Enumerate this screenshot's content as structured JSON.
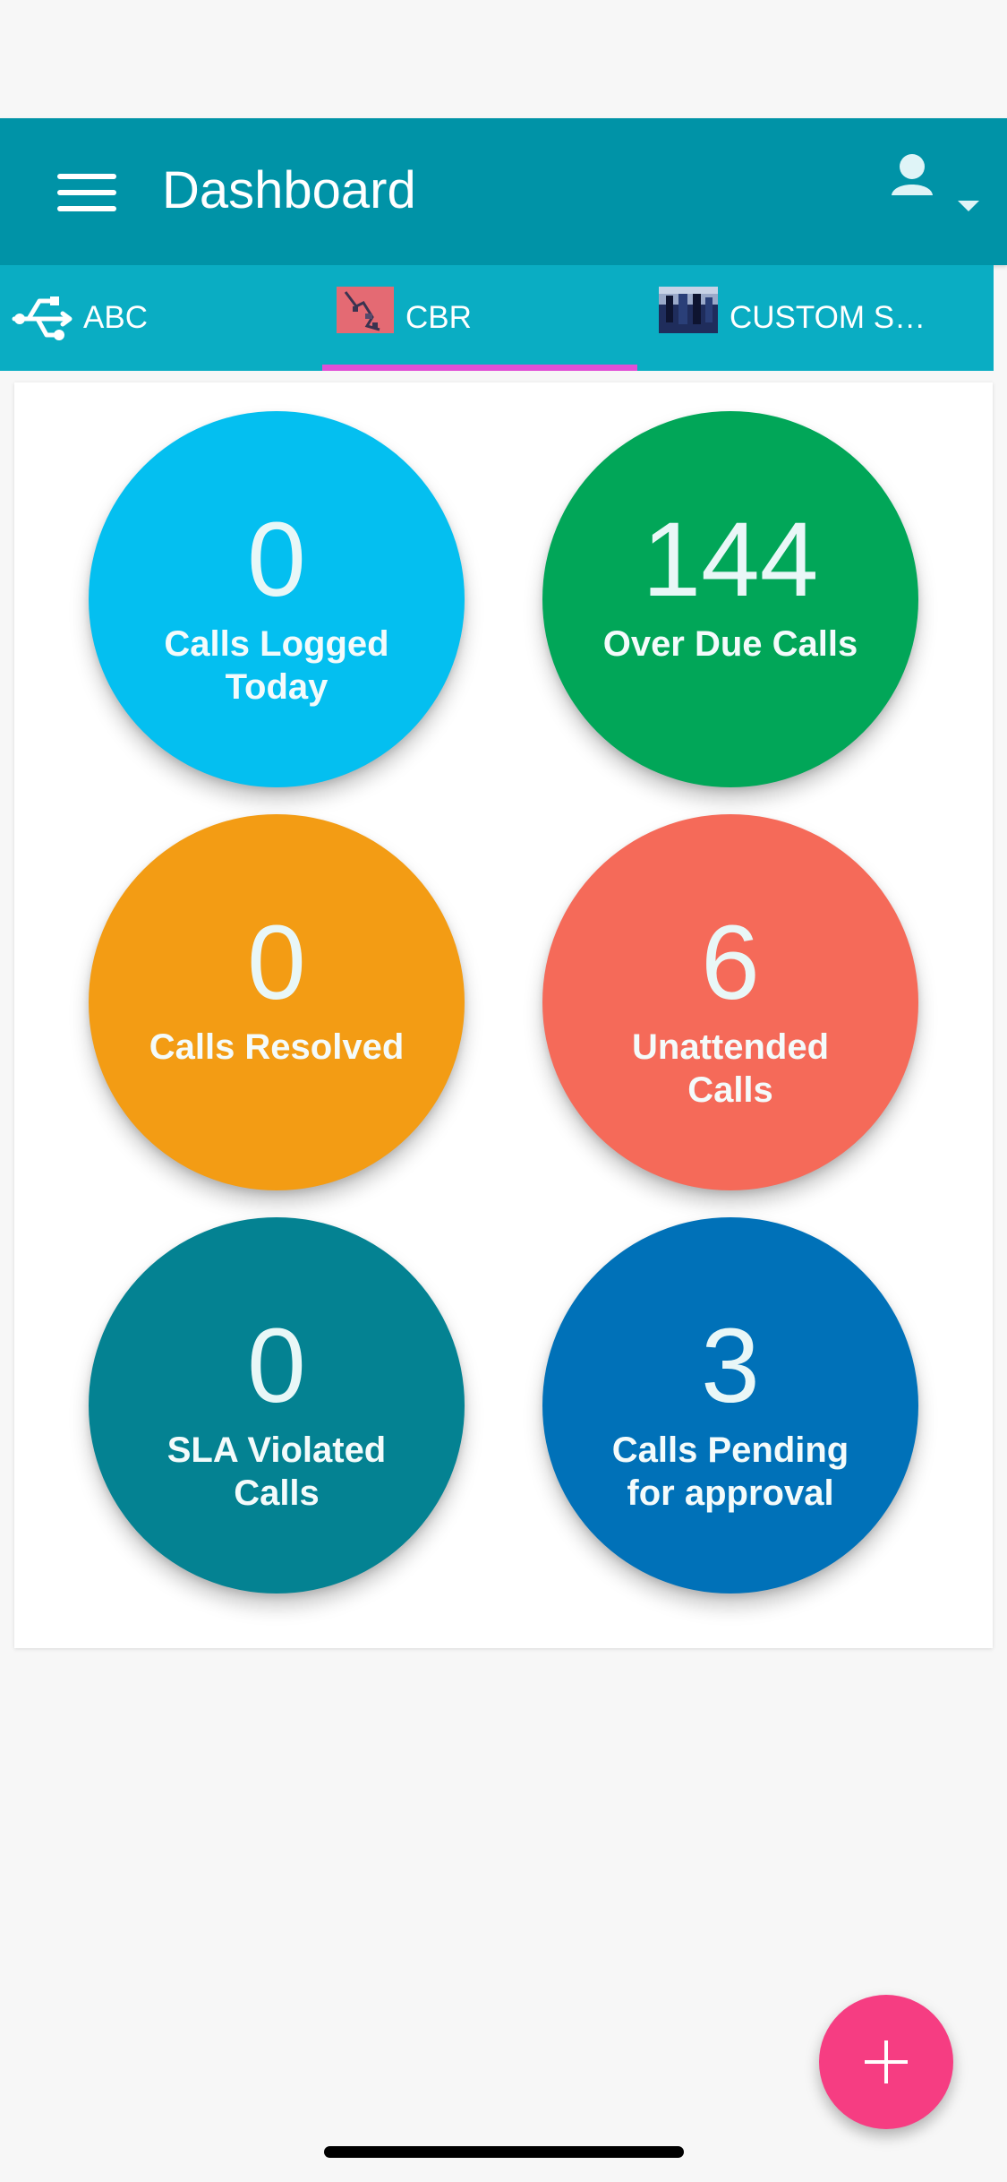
{
  "app": {
    "title": "Dashboard",
    "colors": {
      "appbar": "#0093a7",
      "tabbar": "#0aadc3",
      "active_indicator": "#e14fd6",
      "fab": "#f63d82"
    }
  },
  "tabs": [
    {
      "label": "ABC",
      "icon": "usb-icon"
    },
    {
      "label": "CBR",
      "icon": "thumbnail-image",
      "active": true
    },
    {
      "label": "CUSTOM S…",
      "icon": "thumbnail-image"
    }
  ],
  "stats": [
    {
      "value": "0",
      "label": "Calls Logged Today",
      "color": "#04bff0"
    },
    {
      "value": "144",
      "label": "Over Due Calls",
      "color": "#01a658"
    },
    {
      "value": "0",
      "label": "Calls Resolved",
      "color": "#f39c14"
    },
    {
      "value": "6",
      "label": "Unattended Calls",
      "color": "#f56a59"
    },
    {
      "value": "0",
      "label": "SLA Violated Calls",
      "color": "#048292"
    },
    {
      "value": "3",
      "label": "Calls Pending for approval",
      "color": "#0071b8"
    }
  ],
  "icons": {
    "menu": "menu-icon",
    "user": "user-icon",
    "dropdown": "chevron-down-icon",
    "fab": "plus-icon"
  }
}
